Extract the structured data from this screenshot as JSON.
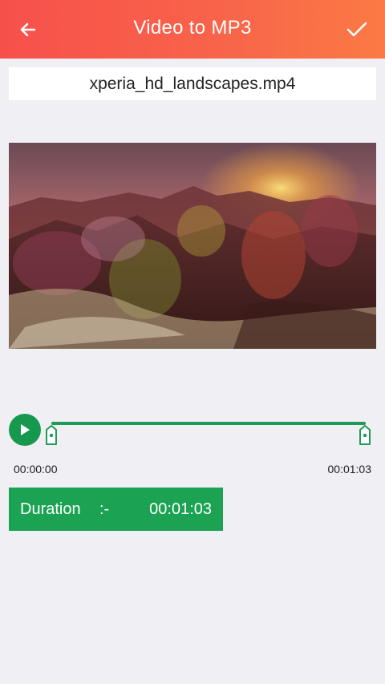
{
  "header": {
    "title": "Video to MP3",
    "back_icon": "arrow-left-icon",
    "confirm_icon": "checkmark-icon",
    "gradient": [
      "#f7504b",
      "#fb7a44"
    ]
  },
  "file": {
    "name": "xperia_hd_landscapes.mp4"
  },
  "player": {
    "play_icon": "play-icon",
    "start_time": "00:00:00",
    "end_time": "00:01:03",
    "accent": "#16994f"
  },
  "duration": {
    "label": "Duration",
    "separator": ":-",
    "value": "00:01:03"
  }
}
